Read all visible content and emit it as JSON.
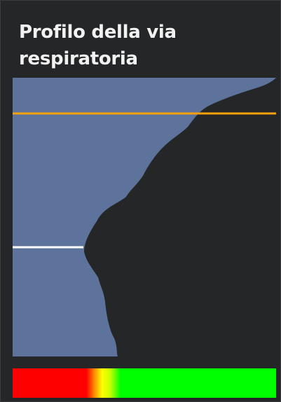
{
  "panel": {
    "title": "Profilo della via respiratoria"
  },
  "colors": {
    "background": "#252628",
    "airway_fill": "#5e739c",
    "reference_line_upper": "#f5a00d",
    "reference_line_lower": "#ffffff",
    "colorbar_red": "#ff0000",
    "colorbar_yellow": "#ffff00",
    "colorbar_green": "#00ff00"
  },
  "icons": {
    "colorbar": "gradient-legend"
  }
}
